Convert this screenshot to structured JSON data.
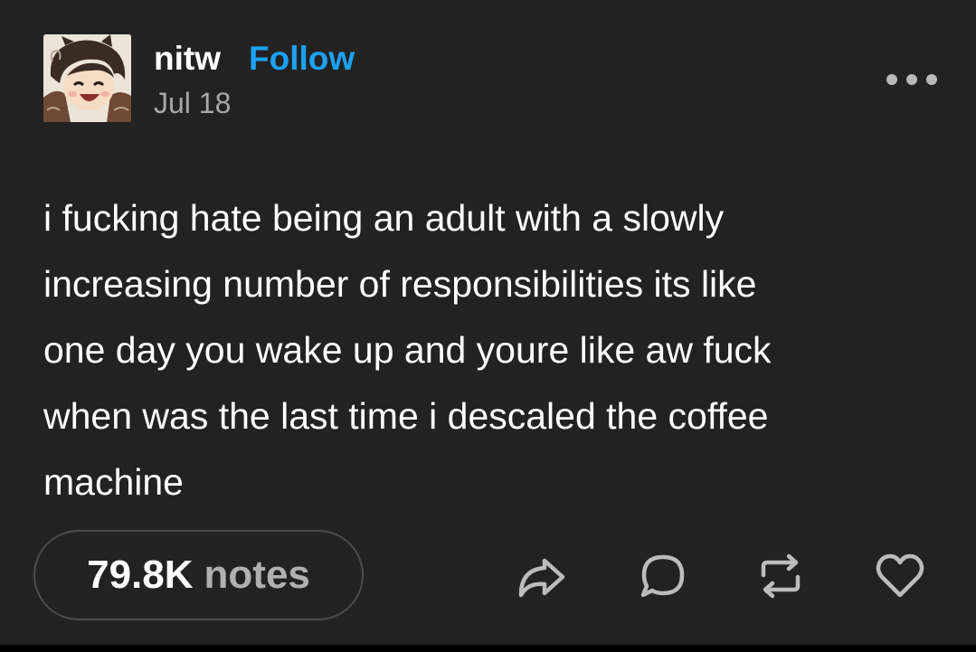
{
  "post": {
    "username": "nitw",
    "follow_label": "Follow",
    "date": "Jul 18",
    "body": "i fucking hate being an adult with a slowly\nincreasing number of responsibilities its like\none day you wake up and youre like aw fuck\nwhen was the last time i descaled the coffee\nmachine",
    "notes_count": "79.8K",
    "notes_label": "notes"
  },
  "icons": {
    "more": "more-horizontal-icon",
    "share": "share-icon",
    "reply": "reply-icon",
    "reblog": "reblog-icon",
    "like": "heart-icon"
  },
  "colors": {
    "background": "#222222",
    "accent_follow": "#1da1f2",
    "secondary_text": "#a8a8a8",
    "icon": "#bcbcbc"
  }
}
